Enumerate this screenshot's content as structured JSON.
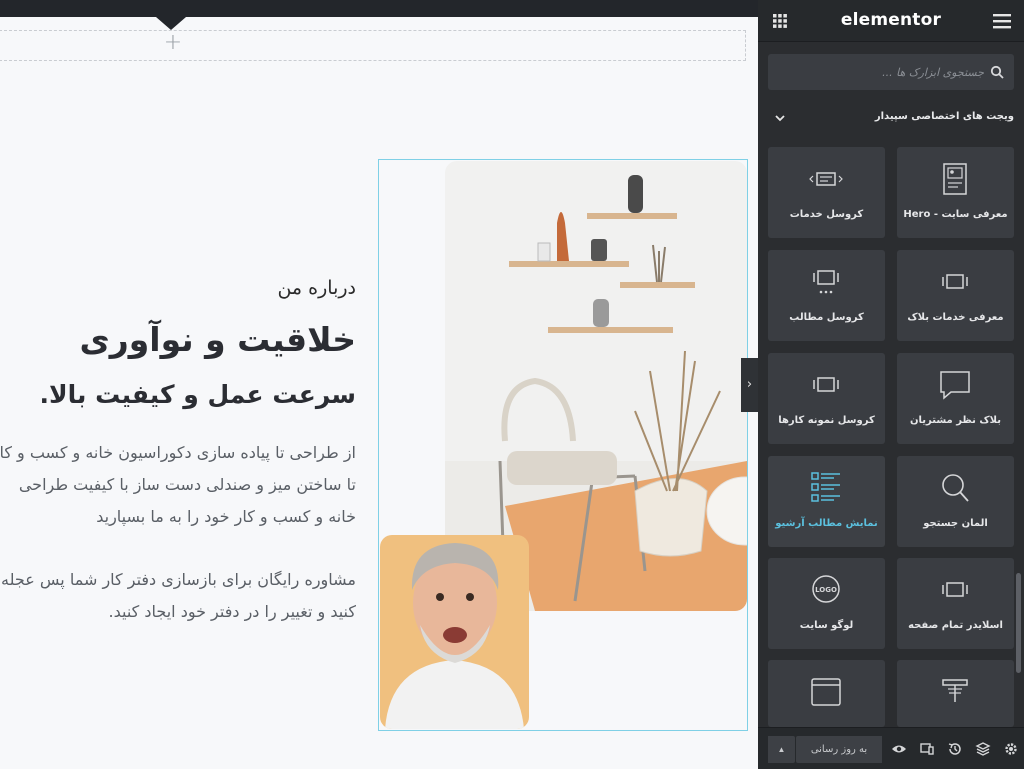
{
  "canvas": {
    "add_section_label": "+",
    "about": {
      "kicker": "درباره من",
      "title": "خلاقیت و نوآوری",
      "subtitle": "سرعت عمل و کیفیت بالا.",
      "paragraph_1_lines": [
        "از طراحی تا پیاده سازی دکوراسیون خانه و کسب و کا",
        "تا ساختن میز و صندلی دست ساز با کیفیت طراحی",
        "خانه و کسب و کار خود را به ما بسپارید"
      ],
      "paragraph_2_lines": [
        "مشاوره رایگان برای بازسازی دفتر کار شما پس عجله",
        "کنید و تغییر را در دفتر خود ایجاد کنید."
      ]
    },
    "panel_toggle_label": "›"
  },
  "panel": {
    "brand": "elementor",
    "search": {
      "placeholder": "جستجوی ابزارک ها ..."
    },
    "category": {
      "title": "ویجت های اختصاصی سپیدار"
    },
    "widgets": [
      {
        "label": "معرفی سایت - Hero",
        "icon": "hero-icon"
      },
      {
        "label": "کروسل خدمات",
        "icon": "services-carousel-icon"
      },
      {
        "label": "معرفی خدمات بلاک",
        "icon": "service-block-icon"
      },
      {
        "label": "کروسل مطالب",
        "icon": "posts-carousel-icon"
      },
      {
        "label": "بلاک نظر مشتریان",
        "icon": "testimonial-icon"
      },
      {
        "label": "کروسل نمونه کارها",
        "icon": "portfolio-carousel-icon"
      },
      {
        "label": "المان جستجو",
        "icon": "search-element-icon"
      },
      {
        "label": "نمایش مطالب آرشیو",
        "icon": "archive-posts-icon",
        "active": true
      },
      {
        "label": "اسلایدر تمام صفحه",
        "icon": "fullscreen-slider-icon"
      },
      {
        "label": "لوگو سایت",
        "icon": "logo-icon",
        "logo_text": "LOGO"
      },
      {
        "label": "",
        "icon": "header-icon"
      },
      {
        "label": "",
        "icon": "window-icon"
      }
    ],
    "footer": {
      "publish_label": "به روز رسانی",
      "publish_arrow": "▲"
    }
  },
  "colors": {
    "panel_bg": "#2b2d30",
    "tile_bg": "#3a3d42",
    "accent": "#5bc0de",
    "widget_outline": "#7fd0e6"
  }
}
